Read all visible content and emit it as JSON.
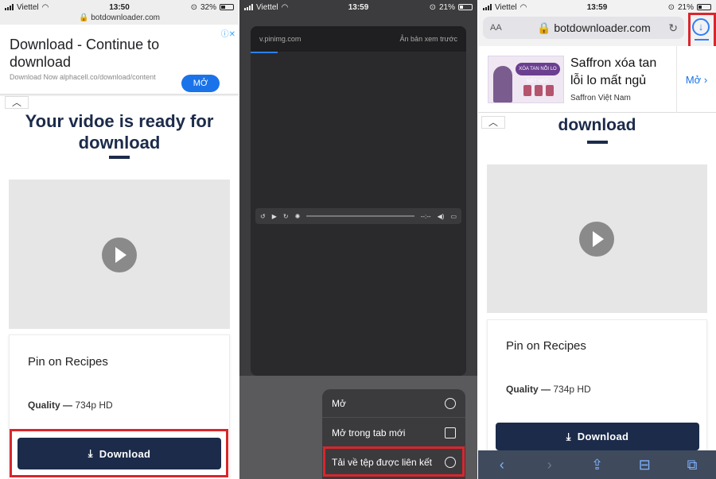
{
  "panel1": {
    "status": {
      "carrier": "Viettel",
      "time": "13:50",
      "battery": "32%"
    },
    "url": "botdownloader.com",
    "ad": {
      "title": "Download - Continue to download",
      "subtitle": "Download Now alphacell.co/download/content",
      "open_label": "MỞ"
    },
    "heading": "Your vidoe is ready for download",
    "card": {
      "title": "Pin on Recipes",
      "quality_label": "Quality —",
      "quality_value": "734p HD"
    },
    "download_label": "Download"
  },
  "panel2": {
    "status": {
      "carrier": "Viettel",
      "time": "13:59",
      "battery": "21%"
    },
    "preview_host": "v.pinimg.com",
    "reader_label": "Ản bản xem trước",
    "time_readout": "--:--",
    "menu": [
      {
        "label": "Mở",
        "icon": "compass-icon"
      },
      {
        "label": "Mở trong tab mới",
        "icon": "new-tab-icon"
      },
      {
        "label": "Tải về tệp được liên kết",
        "icon": "download-circle-icon"
      }
    ]
  },
  "panel3": {
    "status": {
      "carrier": "Viettel",
      "time": "13:59",
      "battery": "21%"
    },
    "aa_label": "AA",
    "url": "botdownloader.com",
    "ad": {
      "title": "Saffron xóa tan lỗi lo mất ngủ",
      "brand": "Saffron Việt Nam",
      "open_label": "Mở",
      "image_text": "XÓA TAN NỖI LO MẤT NGỦ"
    },
    "heading": "download",
    "card": {
      "title": "Pin on Recipes",
      "quality_label": "Quality —",
      "quality_value": "734p HD"
    },
    "download_label": "Download"
  },
  "colors": {
    "navy": "#1c2b4a",
    "highlight": "#d9262c",
    "ios_blue": "#2f7ff5"
  }
}
